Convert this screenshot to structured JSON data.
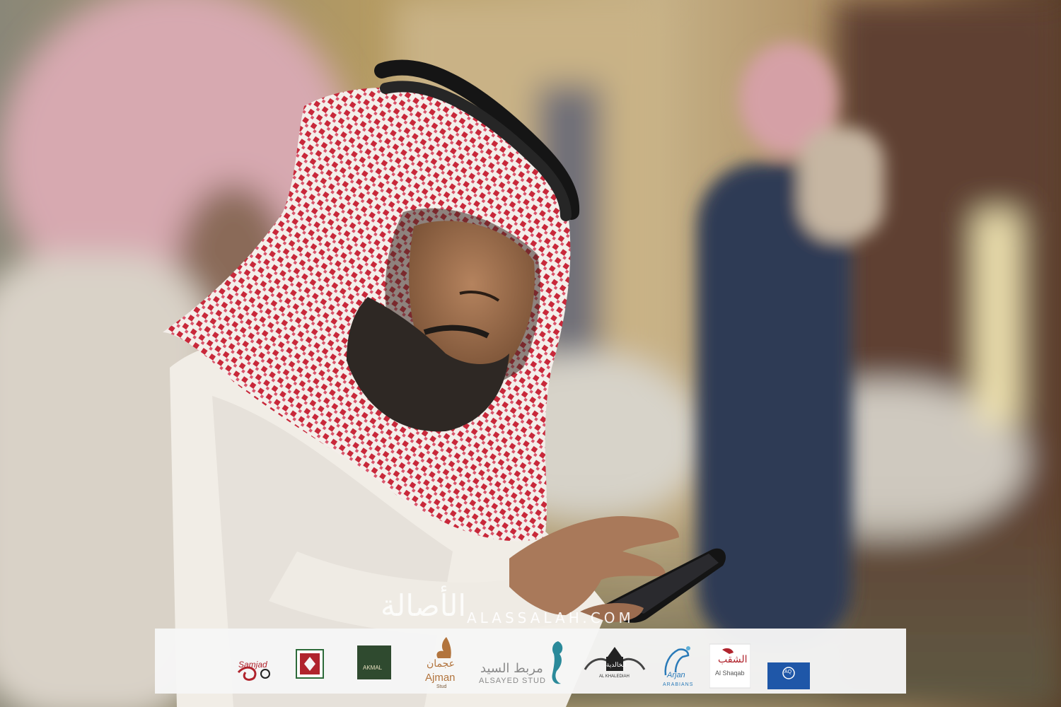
{
  "watermark": {
    "arabic_text": "الأصالة",
    "url_text": "ALASSALAH.COM"
  },
  "sponsors": [
    {
      "icon": "samjad-logo",
      "label": "Samjad"
    },
    {
      "icon": "shield-crest-logo",
      "label": ""
    },
    {
      "icon": "akmal-logo",
      "label": "AKMAL"
    },
    {
      "icon": "ajman-stud-logo",
      "label_ar": "عجمان",
      "label": "Ajman",
      "sub": "Stud"
    },
    {
      "icon": "alsayed-stud-logo",
      "label_ar": "مربط السيد",
      "label": "ALSAYED STUD"
    },
    {
      "icon": "al-khalediah-logo",
      "label_ar": "الخالدية",
      "label": "AL KHALEDIAH"
    },
    {
      "icon": "arjan-arabians-logo",
      "label": "Arjan",
      "sub": "ARABIANS"
    },
    {
      "icon": "al-shaqab-logo",
      "label_ar": "الشقب",
      "label": "Al Shaqab"
    },
    {
      "icon": "al-qudra-stud-logo",
      "label": "AQ"
    }
  ],
  "colors": {
    "shemagh_red": "#c8283a",
    "shemagh_white": "#f4eeea",
    "agal_black": "#151515",
    "background_warm": "#b39c74",
    "bar_bg": "#f6f6f6",
    "akmal_green": "#2f4a2f",
    "ajman_brown": "#b2743d",
    "alsayed_teal": "#2b8a9a",
    "arjan_blue": "#2a7ab8",
    "shaqab_red": "#b0242d",
    "qudra_blue": "#1f57a8"
  }
}
